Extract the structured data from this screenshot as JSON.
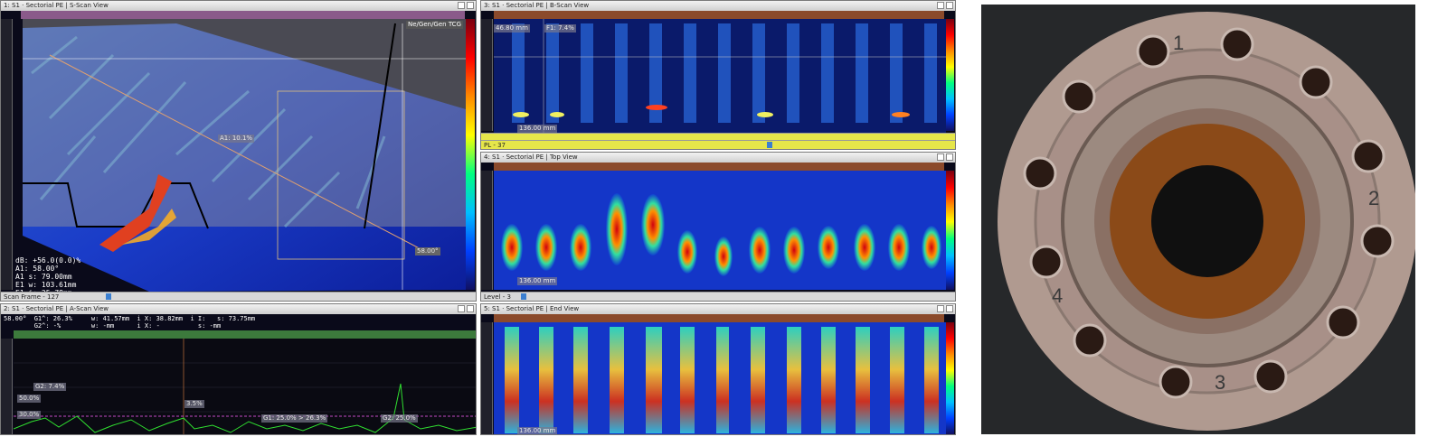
{
  "sscan": {
    "title": "1: S1 · Sectorial PE | S-Scan View",
    "toolbar_label": "Ne/Gen/Gen TCG",
    "cursor_label": "A1: 10.1%",
    "angle_label": "58.00°",
    "readout": "dB: +56.0(0.0)%\nA1: 58.00°\nA1 s: 79.00mm\nE1 w: 103.61mm\nE1 i: 25.78mm",
    "scrollbar_label": "Scan Frame - 127"
  },
  "ascan": {
    "title": "2: S1 · Sectorial PE | A-Scan View",
    "readout_line1": "58.00°  G1^: 26.3%     w: 41.57mm  i X: 38.82mm  i I:   s: 73.75mm",
    "readout_line2": "        G2^: -%        w: -mm      i X: -          s: -mm",
    "gate2_label": "G2: 7.4%",
    "level50_label": "50.0%",
    "level30_label": "30.0%",
    "peak_label": "3.5%",
    "gate1_label": "G1: 25.0% > 26.3%",
    "gate_right_label": "G2: 25.0%"
  },
  "bscan": {
    "title": "3: S1 · Sectorial PE | B-Scan View",
    "depth_label": "46.80 mm",
    "gate_label": "F1: 7.4%",
    "scale_label": "136.00 mm",
    "scrollbar_label": "PL - 37"
  },
  "topview": {
    "title": "4: S1 · Sectorial PE | Top View",
    "scale_label": "136.00 mm",
    "scrollbar_label": "Level - 3"
  },
  "endview": {
    "title": "5: S1 · Sectorial PE | End View",
    "scale_label": "136.00 mm"
  },
  "photo": {
    "marks": [
      "1",
      "2",
      "3",
      "4"
    ]
  },
  "colors": {
    "panel_bg": "#0a0a1a",
    "scan_blue": "#1030c0",
    "hot_red": "#d01010",
    "flange_metal": "#a89088",
    "rust": "#8b4a18"
  }
}
